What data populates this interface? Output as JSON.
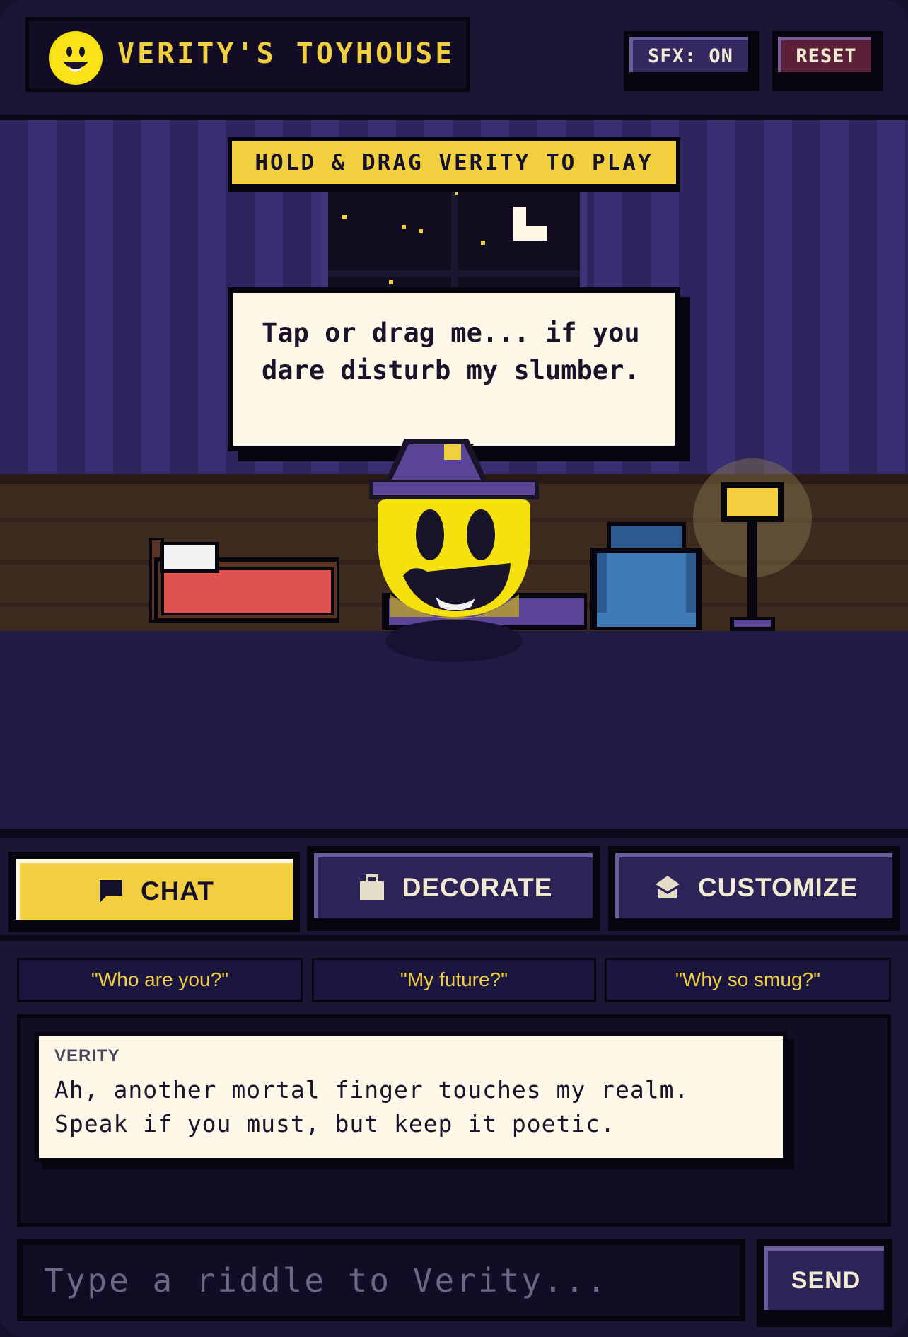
{
  "header": {
    "title": "VERITY'S TOYHOUSE",
    "logo_icon": "smiley-face-icon",
    "sfx_label": "SFX: ON",
    "reset_label": "RESET"
  },
  "room": {
    "banner": "HOLD & DRAG VERITY TO PLAY",
    "speech": "Tap or drag me... if you dare disturb my slumber.",
    "objects": [
      "window",
      "moon-icon",
      "bed",
      "rug",
      "armchair",
      "floor-lamp",
      "verity-character"
    ]
  },
  "tabs": [
    {
      "label": "CHAT",
      "icon": "chat-bubble-icon",
      "active": true
    },
    {
      "label": "DECORATE",
      "icon": "briefcase-icon",
      "active": false
    },
    {
      "label": "CUSTOMIZE",
      "icon": "graduation-cap-icon",
      "active": false
    }
  ],
  "chat": {
    "suggestions": [
      "\"Who are you?\"",
      "\"My future?\"",
      "\"Why so smug?\""
    ],
    "messages": [
      {
        "speaker": "VERITY",
        "text": "Ah, another mortal finger touches my realm. Speak if you must, but keep it poetic."
      }
    ],
    "input_placeholder": "Type a riddle to Verity...",
    "input_value": "",
    "send_label": "SEND"
  },
  "colors": {
    "accent_yellow": "#f2cf3e",
    "background": "#1c1535",
    "wall": "#2e2460",
    "floor": "#3f2a20",
    "reset_red": "#5c2038"
  }
}
